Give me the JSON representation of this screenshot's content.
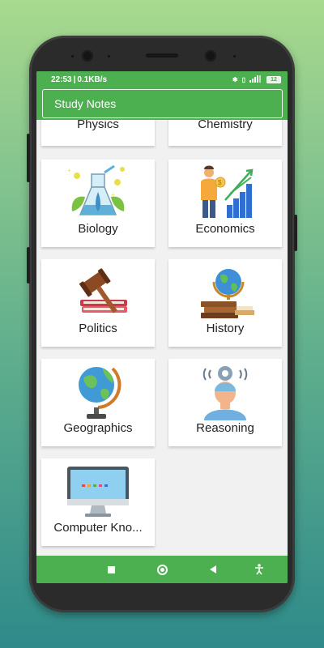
{
  "status_bar": {
    "time": "22:53",
    "speed": "0.1KB/s",
    "battery": "12"
  },
  "app_bar": {
    "title": "Study Notes"
  },
  "subjects": [
    {
      "label": "Physics",
      "icon": "physics-icon"
    },
    {
      "label": "Chemistry",
      "icon": "chemistry-icon"
    },
    {
      "label": "Biology",
      "icon": "biology-flask-icon"
    },
    {
      "label": "Economics",
      "icon": "economics-growth-icon"
    },
    {
      "label": "Politics",
      "icon": "gavel-books-icon"
    },
    {
      "label": "History",
      "icon": "globe-books-icon"
    },
    {
      "label": "Geographics",
      "icon": "desk-globe-icon"
    },
    {
      "label": "Reasoning",
      "icon": "thinking-person-icon"
    },
    {
      "label": "Computer Kno...",
      "icon": "monitor-icon"
    }
  ],
  "nav_bar": {
    "icons": [
      "stop-icon",
      "home-icon",
      "back-icon",
      "accessibility-icon"
    ]
  },
  "colors": {
    "primary": "#4caf50",
    "background": "#f1f1f1",
    "card": "#ffffff"
  }
}
